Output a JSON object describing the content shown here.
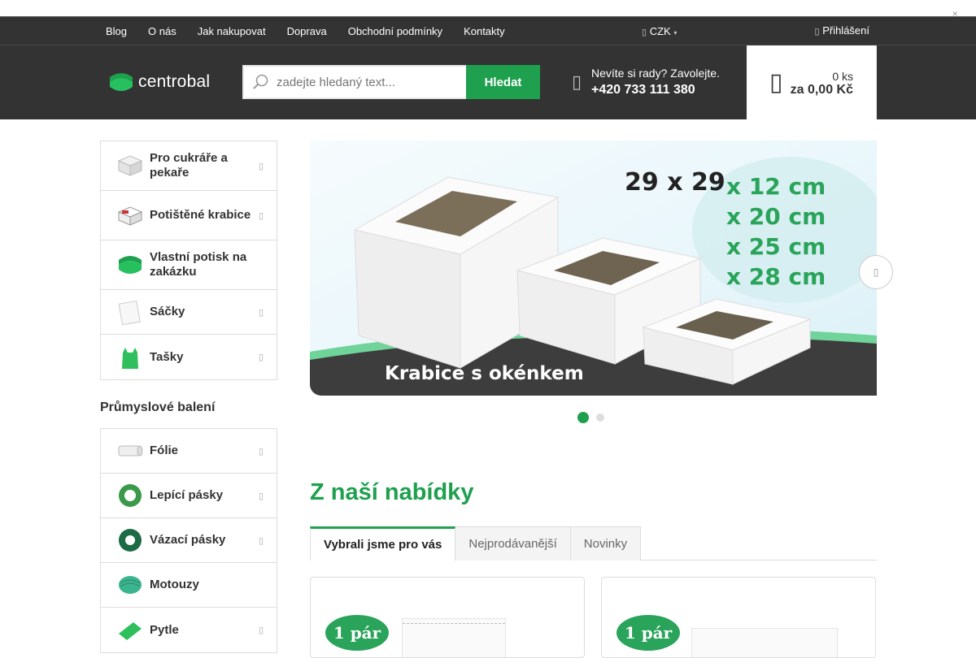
{
  "topnav": {
    "links": [
      "Blog",
      "O nás",
      "Jak nakupovat",
      "Doprava",
      "Obchodní podmínky",
      "Kontakty"
    ],
    "currency": "CZK",
    "login": "Přihlášení"
  },
  "header": {
    "logo_text": "centrobal",
    "search_placeholder": "zadejte hledaný text...",
    "search_button": "Hledat",
    "phone_prompt": "Nevíte si rady? Zavolejte.",
    "phone_number": "+420 733 111 380",
    "cart_count": "0 ks",
    "cart_total": "za 0,00 Kč"
  },
  "sidebar": {
    "categories": [
      {
        "label": "Pro cukráře a pekaře",
        "has_arrow": true
      },
      {
        "label": "Potištěné krabice",
        "has_arrow": true
      },
      {
        "label": "Vlastní potisk na zakázku",
        "has_arrow": false
      },
      {
        "label": "Sáčky",
        "has_arrow": true
      },
      {
        "label": "Tašky",
        "has_arrow": true
      }
    ],
    "section_title": "Průmyslové balení",
    "industrial": [
      {
        "label": "Fólie",
        "has_arrow": true
      },
      {
        "label": "Lepící pásky",
        "has_arrow": true
      },
      {
        "label": "Vázací pásky",
        "has_arrow": true
      },
      {
        "label": "Motouzy",
        "has_arrow": false
      },
      {
        "label": "Pytle",
        "has_arrow": true
      }
    ]
  },
  "banner": {
    "dims_line1": "29 x 29",
    "dims_lines": [
      "x 12 cm",
      "x 20 cm",
      "x 25 cm",
      "x 28 cm"
    ],
    "caption": "Krabice s okénkem",
    "slides": 2,
    "active_slide": 1
  },
  "offer": {
    "title": "Z naší nabídky",
    "tabs": [
      "Vybrali jsme pro vás",
      "Nejprodávanější",
      "Novinky"
    ],
    "active_tab": 0,
    "products": [
      {
        "badge": "1 pár"
      },
      {
        "badge": "1 pár"
      }
    ]
  },
  "colors": {
    "brand_green": "#1ea04e",
    "header_bg": "#333333"
  }
}
